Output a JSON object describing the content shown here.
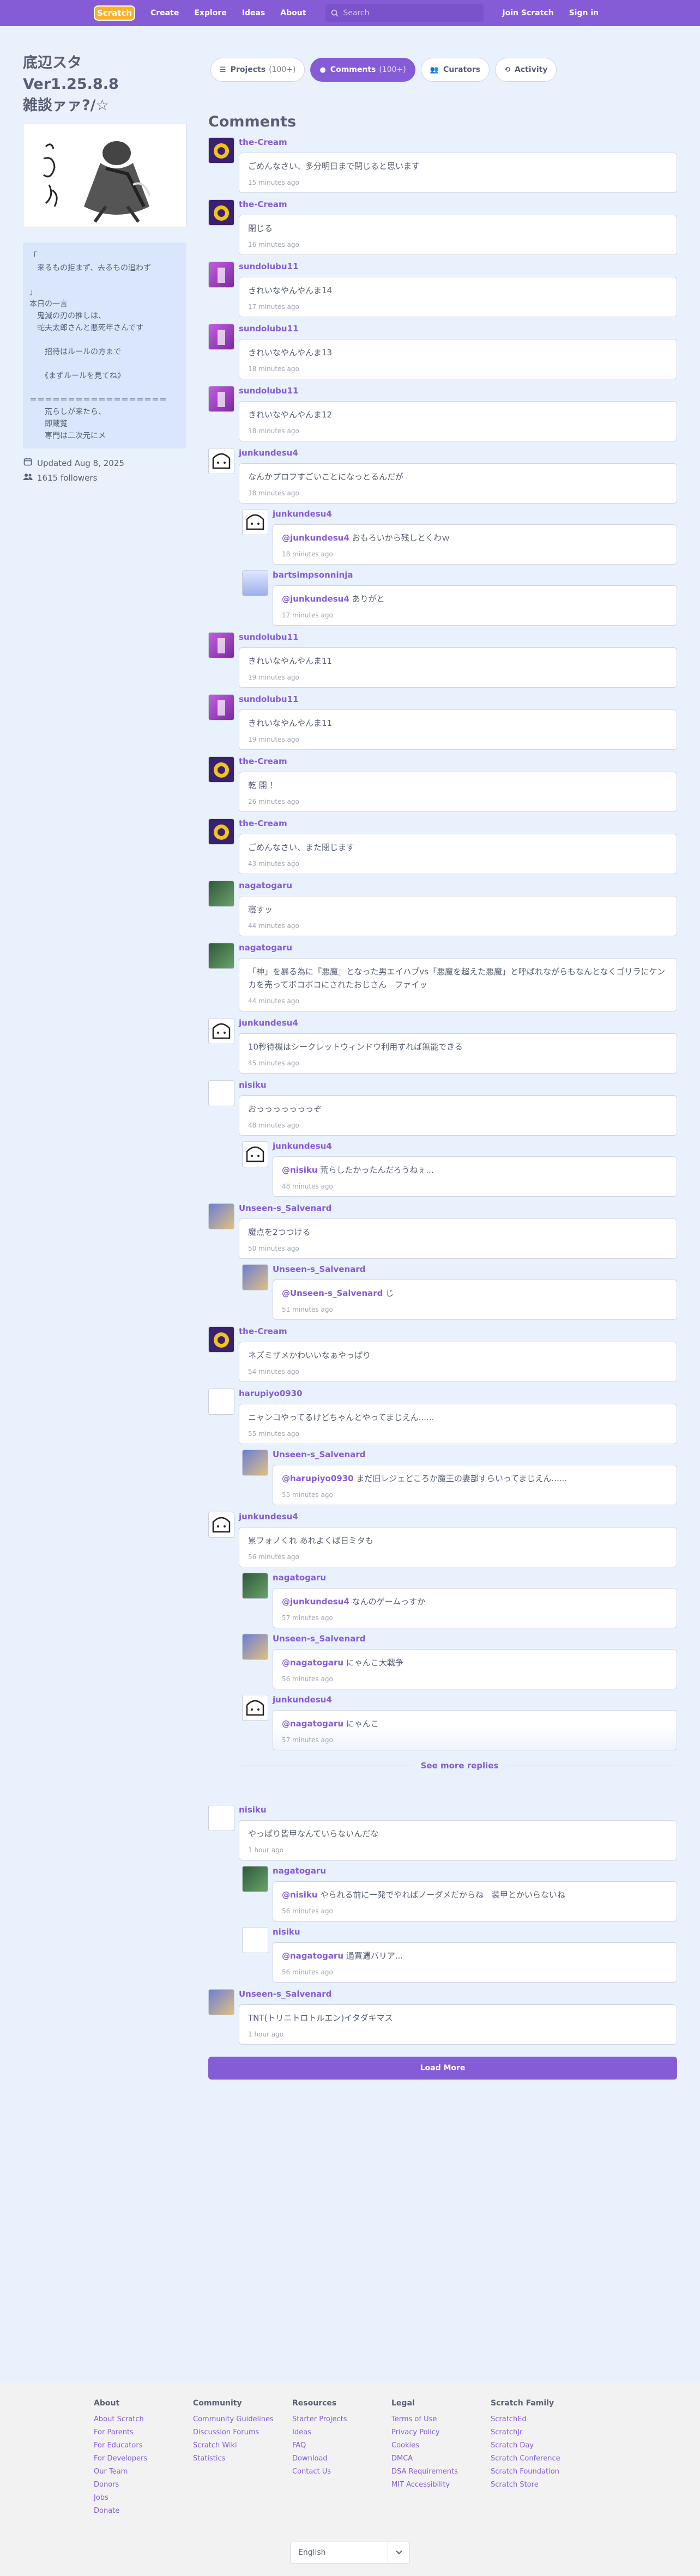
{
  "nav": {
    "logo": "Scratch",
    "links": [
      "Create",
      "Explore",
      "Ideas",
      "About"
    ],
    "search_placeholder": "Search",
    "join": "Join Scratch",
    "signin": "Sign in"
  },
  "studio": {
    "title": "底辺スタ\nVer1.25.8.8\n雑談ァァ?/☆",
    "description": "「\n　来るもの拒まず、去るもの追わず\n\n」\n本日の一言\n　鬼滅の刃の推しは、\n　蛇夫太郎さんと悪死年さんです\n\n　　招待はルールの方まで\n\n　　《まずルールを見てね》\n\n＝＝＝＝＝＝＝＝＝＝＝＝＝＝＝＝＝＝\n　　荒らしが来たら、\n　　即蔵覧\n　　専門は二次元にメ",
    "updated": "Updated Aug 8, 2025",
    "followers": "1615 followers"
  },
  "tabs": [
    {
      "label": "Projects",
      "count": "(100+)"
    },
    {
      "label": "Comments",
      "count": "(100+)"
    },
    {
      "label": "Curators",
      "count": ""
    },
    {
      "label": "Activity",
      "count": ""
    }
  ],
  "comments_heading": "Comments",
  "comments": [
    {
      "user": "the-Cream",
      "text": "ごめんなさい、多分明日まで閉じると思います",
      "time": "15 minutes ago"
    },
    {
      "user": "the-Cream",
      "text": "閉じる",
      "time": "16 minutes ago"
    },
    {
      "user": "sundolubu11",
      "text": "きれいなやんやんま14",
      "time": "17 minutes ago"
    },
    {
      "user": "sundolubu11",
      "text": "きれいなやんやんま13",
      "time": "18 minutes ago"
    },
    {
      "user": "sundolubu11",
      "text": "きれいなやんやんま12",
      "time": "18 minutes ago"
    },
    {
      "user": "junkundesu4",
      "text": "なんかプロフすごいことになっとるんだが",
      "time": "18 minutes ago"
    },
    {
      "user": "junkundesu4",
      "mention": "@junkundesu4",
      "text": " おもろいから残しとくわｗ",
      "time": "18 minutes ago"
    },
    {
      "user": "bartsimpsonninja",
      "mention": "@junkundesu4",
      "text": " ありがと",
      "time": "17 minutes ago"
    },
    {
      "user": "sundolubu11",
      "text": "きれいなやんやんま11",
      "time": "19 minutes ago"
    },
    {
      "user": "sundolubu11",
      "text": "きれいなやんやんま11",
      "time": "19 minutes ago"
    },
    {
      "user": "the-Cream",
      "text": "乾 開 ！",
      "time": "26 minutes ago"
    },
    {
      "user": "the-Cream",
      "text": "ごめんなさい、また閉じます",
      "time": "43 minutes ago"
    },
    {
      "user": "nagatogaru",
      "text": "寝すッ",
      "time": "44 minutes ago"
    },
    {
      "user": "nagatogaru",
      "text": "「神」を暴る為に『悪魔』となった男エイハブvs「悪魔を超えた悪魔」と呼ばれながらもなんとなくゴリラにケンカを売ってボコボコにされたおじさん　ファイッ",
      "time": "44 minutes ago"
    },
    {
      "user": "junkundesu4",
      "text": "10秒待機はシークレットウィンドウ利用すれば無能できる",
      "time": "45 minutes ago"
    },
    {
      "user": "nisiku",
      "text": "おっっっっっっっぞ",
      "time": "48 minutes ago"
    },
    {
      "user": "junkundesu4",
      "mention": "@nisiku",
      "text": " 荒らしたかったんだろうねぇ...",
      "time": "48 minutes ago"
    },
    {
      "user": "Unseen-s_Salvenard",
      "text": "魔点を2つつける",
      "time": "50 minutes ago"
    },
    {
      "user": "Unseen-s_Salvenard",
      "mention": "@Unseen-s_Salvenard",
      "text": " じ",
      "time": "51 minutes ago"
    },
    {
      "user": "the-Cream",
      "text": "ネズミザメかわいいなぁやっぱり",
      "time": "54 minutes ago"
    },
    {
      "user": "harupiyo0930",
      "text": "ニャンコやってるけどちゃんとやってまじえん......",
      "time": "55 minutes ago"
    },
    {
      "user": "Unseen-s_Salvenard",
      "mention": "@harupiyo0930",
      "text": " まだ旧レジェどころか魔王の妻部すらいってまじえん......",
      "time": "55 minutes ago"
    },
    {
      "user": "junkundesu4",
      "text": "累フォノくれ あれよくば日ミタも",
      "time": "56 minutes ago"
    },
    {
      "user": "nagatogaru",
      "mention": "@junkundesu4",
      "text": " なんのゲームっすか",
      "time": "57 minutes ago"
    },
    {
      "user": "Unseen-s_Salvenard",
      "mention": "@nagatogaru",
      "text": " にゃんこ大戦争",
      "time": "56 minutes ago"
    },
    {
      "user": "junkundesu4",
      "mention": "@nagatogaru",
      "text": " にゃんこ",
      "time": "57 minutes ago"
    },
    {
      "user": "nisiku",
      "text": "やっぱり皆甲なんていらないんだな",
      "time": "1 hour ago"
    },
    {
      "user": "nagatogaru",
      "mention": "@nisiku",
      "text": " やられる前に一発でやればノーダメだからね　装甲とかいらないね",
      "time": "56 minutes ago"
    },
    {
      "user": "nisiku",
      "mention": "@nagatogaru",
      "text": " 過買遇バリア...",
      "time": "56 minutes ago"
    },
    {
      "user": "Unseen-s_Salvenard",
      "text": "TNT(トリニトロトルエン)イタダキマス",
      "time": "1 hour ago"
    }
  ],
  "see_more": "See more replies",
  "load_more": "Load More",
  "footer": {
    "columns": [
      {
        "title": "About",
        "links": [
          "About Scratch",
          "For Parents",
          "For Educators",
          "For Developers",
          "Our Team",
          "Donors",
          "Jobs",
          "Donate"
        ]
      },
      {
        "title": "Community",
        "links": [
          "Community Guidelines",
          "Discussion Forums",
          "Scratch Wiki",
          "Statistics"
        ]
      },
      {
        "title": "Resources",
        "links": [
          "Starter Projects",
          "Ideas",
          "FAQ",
          "Download",
          "Contact Us"
        ]
      },
      {
        "title": "Legal",
        "links": [
          "Terms of Use",
          "Privacy Policy",
          "Cookies",
          "DMCA",
          "DSA Requirements",
          "MIT Accessibility"
        ]
      },
      {
        "title": "Scratch Family",
        "links": [
          "ScratchEd",
          "ScratchJr",
          "Scratch Day",
          "Scratch Conference",
          "Scratch Foundation",
          "Scratch Store"
        ]
      }
    ],
    "language": "English"
  },
  "colors": {
    "brand": "#855cd6",
    "background": "#e9f1fc",
    "text": "#575e75"
  }
}
